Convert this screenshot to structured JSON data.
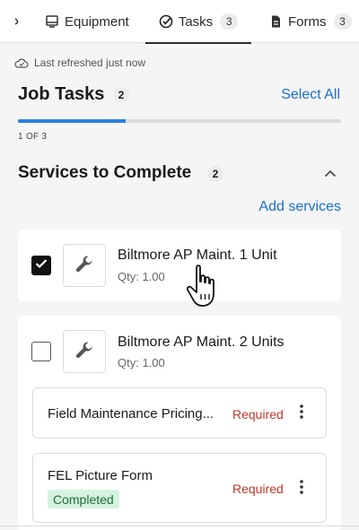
{
  "tabs": [
    {
      "label": "",
      "icon": "partial-tab-icon"
    },
    {
      "label": "Equipment",
      "icon": "equipment-icon"
    },
    {
      "label": "Tasks",
      "icon": "tasks-check-icon",
      "count": "3",
      "active": true
    },
    {
      "label": "Forms",
      "icon": "document-icon",
      "count": "3"
    }
  ],
  "refresh": {
    "text": "Last refreshed just now",
    "icon": "cloud-check-icon"
  },
  "job": {
    "title": "Job Tasks",
    "count": "2",
    "select_all": "Select All",
    "progress_label": "1 OF 3",
    "progress_fraction": 0.333
  },
  "services": {
    "title": "Services to Complete",
    "count": "2",
    "add_label": "Add services",
    "items": [
      {
        "name": "Biltmore AP Maint. 1 Unit",
        "qty": "Qty: 1.00",
        "checked": true,
        "icon": "wrench-icon"
      },
      {
        "name": "Biltmore AP Maint. 2 Units",
        "qty": "Qty: 1.00",
        "checked": false,
        "icon": "wrench-icon",
        "forms": [
          {
            "name": "Field Maintenance Pricing...",
            "status": "Required"
          },
          {
            "name": "FEL Picture Form",
            "status": "Required",
            "badge": "Completed"
          }
        ]
      }
    ]
  },
  "colors": {
    "accent": "#1a6fd1",
    "required": "#c4372a",
    "completed_bg": "#d6f3df",
    "completed_text": "#1f6b3a"
  }
}
